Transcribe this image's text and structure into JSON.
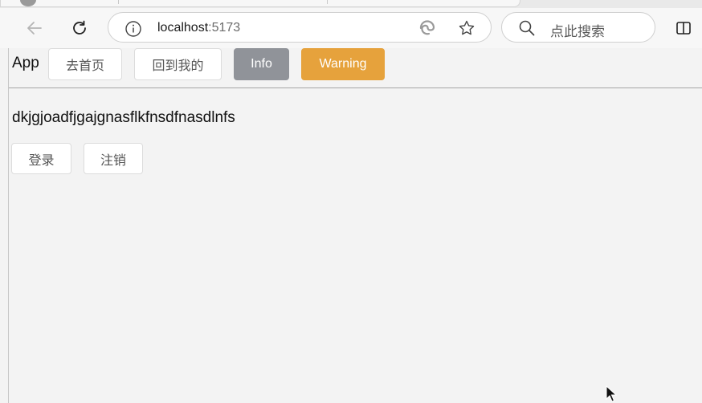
{
  "browser": {
    "url_host": "localhost",
    "url_port": ":5173",
    "search_placeholder": "点此搜索"
  },
  "app": {
    "title": "App",
    "nav": {
      "home_label": "去首页",
      "mine_label": "回到我的",
      "info_label": "Info",
      "warning_label": "Warning"
    },
    "content_text": "dkjgjoadfjgajgnasflkfnsdfnasdlnfs",
    "actions": {
      "login_label": "登录",
      "logout_label": "注销"
    }
  },
  "colors": {
    "info": "#909399",
    "warning": "#e6a23c",
    "page_bg": "#f3f3f3"
  },
  "icons": [
    "back-arrow-icon",
    "refresh-icon",
    "info-icon",
    "edge-icon",
    "star-icon",
    "search-icon",
    "split-screen-icon",
    "mouse-cursor-icon"
  ]
}
